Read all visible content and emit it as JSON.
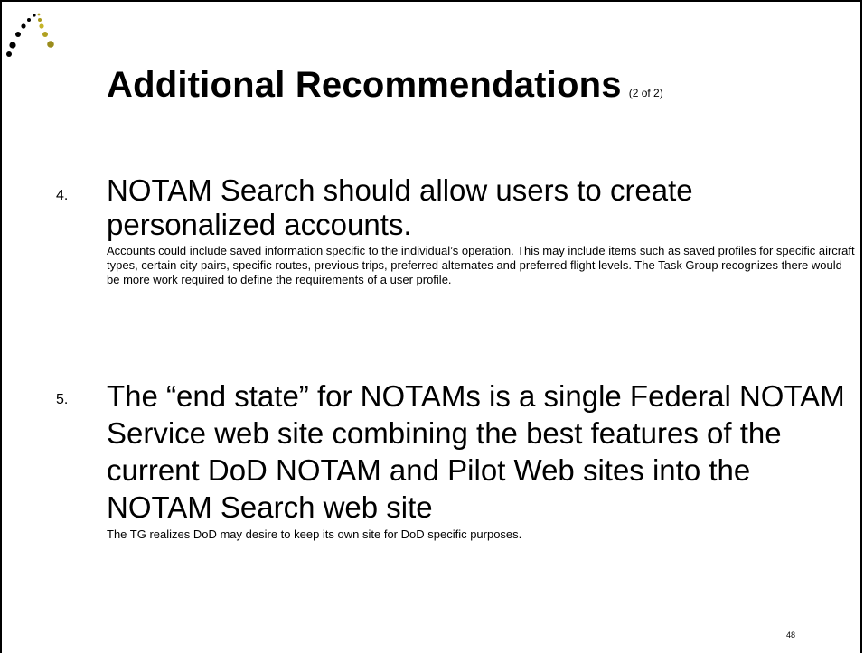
{
  "slide": {
    "title": "Additional Recommendations",
    "title_suffix": "(2 of 2)",
    "page_number": "48"
  },
  "items": [
    {
      "number": "4.",
      "heading": "NOTAM Search should allow users to create personalized accounts.",
      "detail": "Accounts could include saved information specific to the individual’s operation. This may include items such as saved profiles for specific aircraft types, certain city pairs, specific routes, previous trips, preferred alternates and preferred flight levels. The Task Group recognizes there would be more work required to define the requirements of a user profile."
    },
    {
      "number": "5.",
      "heading": "The “end state” for NOTAMs is a single Federal NOTAM Service web site combining the best features of the current DoD NOTAM and Pilot Web sites into the NOTAM Search web site",
      "detail": "The TG realizes DoD may desire to keep its own site for DoD specific purposes."
    }
  ],
  "logo": {
    "icon": "dotted-arc-logo-icon",
    "colors": [
      "#000000",
      "#9a8c1c",
      "#c4b428"
    ]
  }
}
